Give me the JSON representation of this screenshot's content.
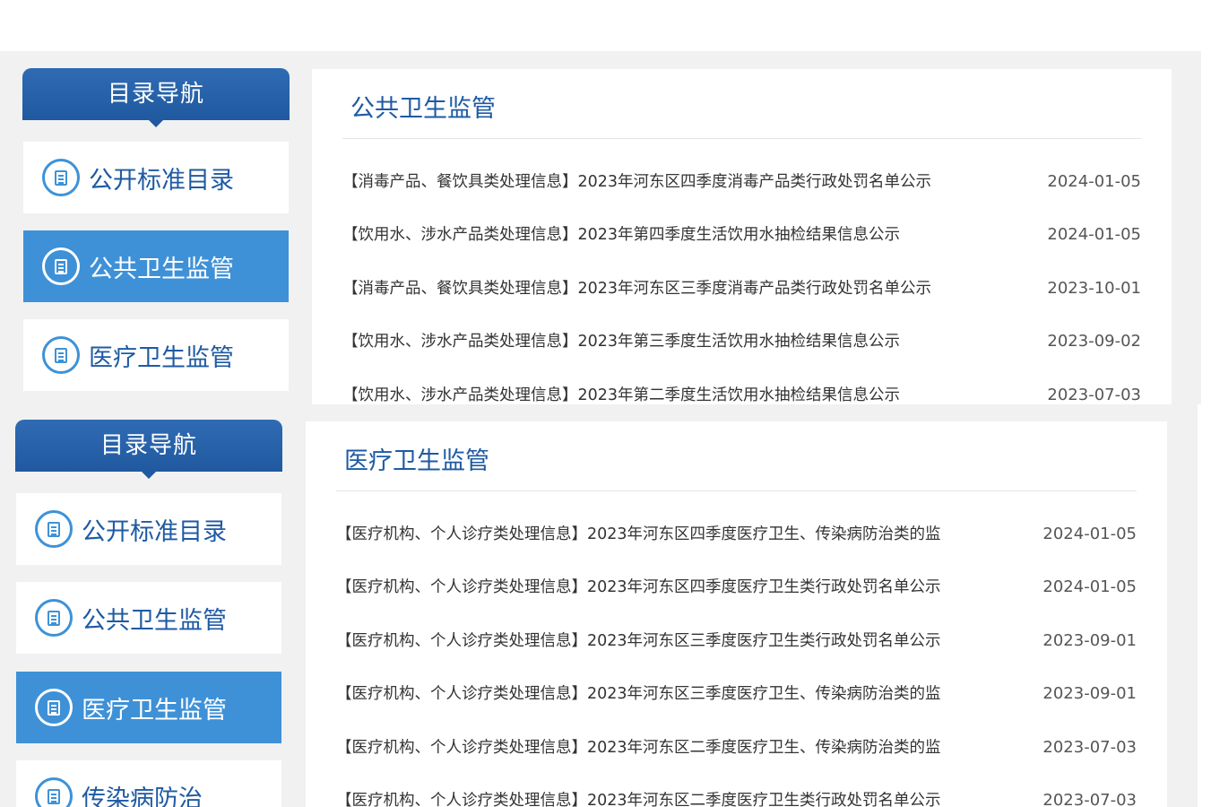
{
  "panel1": {
    "nav": {
      "header": "目录导航",
      "items": [
        {
          "label": "公开标准目录",
          "active": false
        },
        {
          "label": "公共卫生监管",
          "active": true
        },
        {
          "label": "医疗卫生监管",
          "active": false
        }
      ]
    },
    "content": {
      "title": "公共卫生监管",
      "rows": [
        {
          "title": "【消毒产品、餐饮具类处理信息】2023年河东区四季度消毒产品类行政处罚名单公示",
          "date": "2024-01-05"
        },
        {
          "title": "【饮用水、涉水产品类处理信息】2023年第四季度生活饮用水抽检结果信息公示",
          "date": "2024-01-05"
        },
        {
          "title": "【消毒产品、餐饮具类处理信息】2023年河东区三季度消毒产品类行政处罚名单公示",
          "date": "2023-10-01"
        },
        {
          "title": "【饮用水、涉水产品类处理信息】2023年第三季度生活饮用水抽检结果信息公示",
          "date": "2023-09-02"
        },
        {
          "title": "【饮用水、涉水产品类处理信息】2023年第二季度生活饮用水抽检结果信息公示",
          "date": "2023-07-03"
        }
      ]
    }
  },
  "panel2": {
    "nav": {
      "header": "目录导航",
      "items": [
        {
          "label": "公开标准目录",
          "active": false
        },
        {
          "label": "公共卫生监管",
          "active": false
        },
        {
          "label": "医疗卫生监管",
          "active": true
        },
        {
          "label": "传染病防治",
          "active": false
        }
      ]
    },
    "content": {
      "title": "医疗卫生监管",
      "rows": [
        {
          "title": "【医疗机构、个人诊疗类处理信息】2023年河东区四季度医疗卫生、传染病防治类的监",
          "date": "2024-01-05"
        },
        {
          "title": "【医疗机构、个人诊疗类处理信息】2023年河东区四季度医疗卫生类行政处罚名单公示",
          "date": "2024-01-05"
        },
        {
          "title": "【医疗机构、个人诊疗类处理信息】2023年河东区三季度医疗卫生类行政处罚名单公示",
          "date": "2023-09-01"
        },
        {
          "title": "【医疗机构、个人诊疗类处理信息】2023年河东区三季度医疗卫生、传染病防治类的监",
          "date": "2023-09-01"
        },
        {
          "title": "【医疗机构、个人诊疗类处理信息】2023年河东区二季度医疗卫生、传染病防治类的监",
          "date": "2023-07-03"
        },
        {
          "title": "【医疗机构、个人诊疗类处理信息】2023年河东区二季度医疗卫生类行政处罚名单公示",
          "date": "2023-07-03"
        }
      ]
    }
  },
  "colors": {
    "nav_header": "#2a64ac",
    "active_item": "#3e91d7",
    "label_blue": "#1e5aa3",
    "panel_bg": "#f1f1f1"
  }
}
